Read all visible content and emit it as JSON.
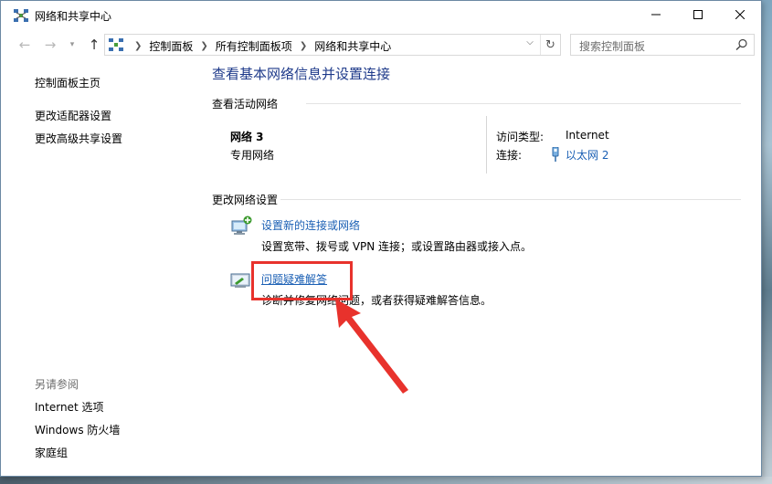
{
  "window": {
    "title": "网络和共享中心"
  },
  "address": {
    "crumbs": [
      "控制面板",
      "所有控制面板项",
      "网络和共享中心"
    ],
    "search_placeholder": "搜索控制面板"
  },
  "sidebar": {
    "items": [
      {
        "label": "控制面板主页"
      },
      {
        "label": "更改适配器设置"
      },
      {
        "label": "更改高级共享设置"
      }
    ],
    "see_also_heading": "另请参阅",
    "see_also": [
      {
        "label": "Internet 选项"
      },
      {
        "label": "Windows 防火墙"
      },
      {
        "label": "家庭组"
      }
    ]
  },
  "main": {
    "title": "查看基本网络信息并设置连接",
    "active_networks_heading": "查看活动网络",
    "network": {
      "name": "网络  3",
      "type": "专用网络",
      "access_type_label": "访问类型:",
      "access_type_value": "Internet",
      "connections_label": "连接:",
      "connections_value": "以太网 2"
    },
    "change_settings_heading": "更改网络设置",
    "tasks": [
      {
        "link": "设置新的连接或网络",
        "description": "设置宽带、拨号或 VPN 连接；或设置路由器或接入点。",
        "icon": "network-setup-icon"
      },
      {
        "link": "问题疑难解答",
        "description": "诊断并修复网络问题，或者获得疑难解答信息。",
        "icon": "troubleshoot-icon"
      }
    ]
  },
  "colors": {
    "link": "#1a5fb4",
    "title": "#1e3a8a",
    "highlight": "#e8322c"
  }
}
